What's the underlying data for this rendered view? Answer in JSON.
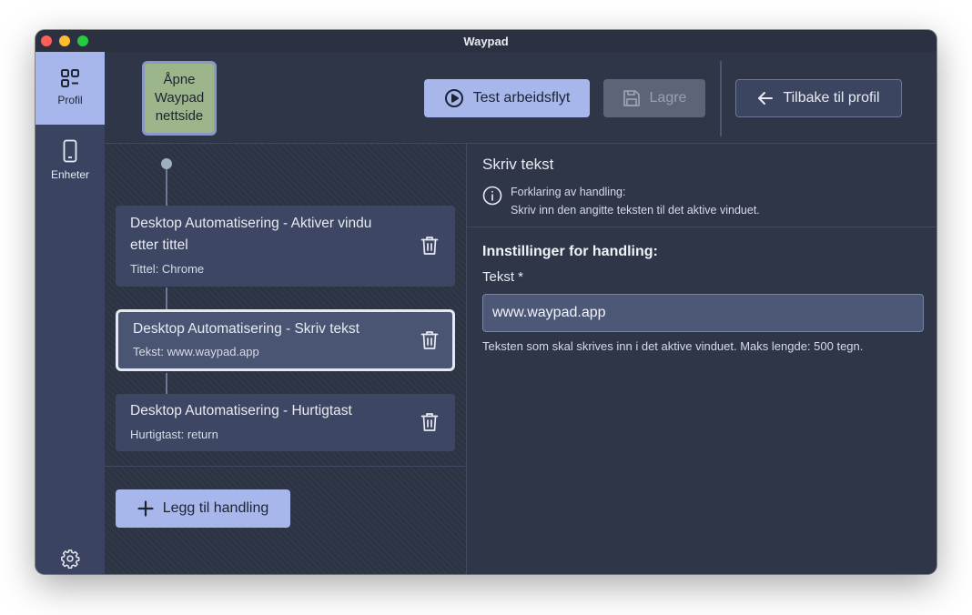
{
  "window": {
    "title": "Waypad"
  },
  "sidebar": {
    "items": [
      {
        "label": "Profil",
        "icon": "grid-icon",
        "active": true
      },
      {
        "label": "Enheter",
        "icon": "phone-icon",
        "active": false
      }
    ],
    "settings_icon": "gear-icon"
  },
  "toolbar": {
    "open_website_label": "Åpne\nWaypad\nnettside",
    "test_label": "Test arbeidsflyt",
    "save_label": "Lagre",
    "back_label": "Tilbake til profil"
  },
  "actions": [
    {
      "title": "Desktop Automatisering - Aktiver vindu etter tittel",
      "subtitle": "Tittel: Chrome",
      "selected": false
    },
    {
      "title": "Desktop Automatisering - Skriv tekst",
      "subtitle": "Tekst: www.waypad.app",
      "selected": true
    },
    {
      "title": "Desktop Automatisering - Hurtigtast",
      "subtitle": "Hurtigtast: return",
      "selected": false
    }
  ],
  "add_action_label": "Legg til handling",
  "detail": {
    "title": "Skriv tekst",
    "explanation_label": "Forklaring av handling:",
    "explanation_text": "Skriv inn den angitte teksten til det aktive vinduet.",
    "settings_title": "Innstillinger for handling:",
    "field_label": "Tekst *",
    "field_value": "www.waypad.app",
    "help_text": "Teksten som skal skrives inn i det aktive vinduet. Maks lengde: 500 tegn."
  },
  "colors": {
    "accent": "#a7b7ec",
    "background": "#2e3648",
    "sidebar": "#3a4461",
    "open_button": "#9db58a"
  }
}
